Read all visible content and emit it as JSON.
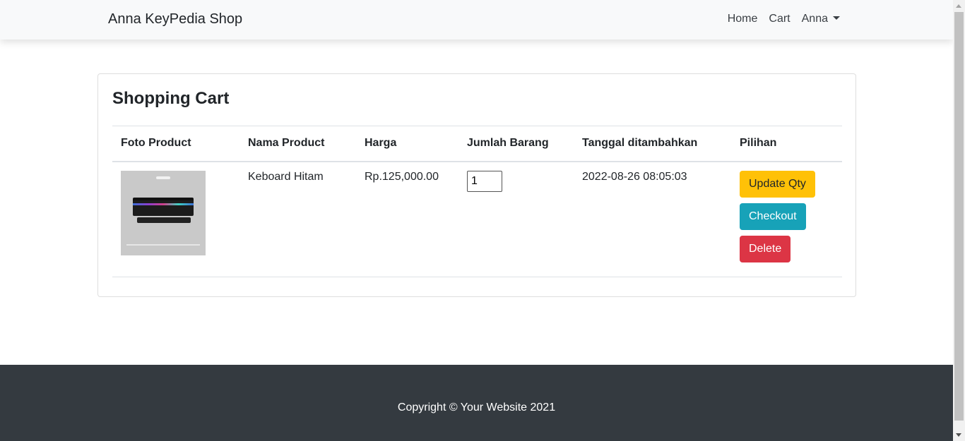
{
  "navbar": {
    "brand": "Anna KeyPedia Shop",
    "links": {
      "home": "Home",
      "cart": "Cart"
    },
    "user": "Anna"
  },
  "cart": {
    "title": "Shopping Cart",
    "headers": {
      "foto": "Foto Product",
      "nama": "Nama Product",
      "harga": "Harga",
      "jumlah": "Jumlah Barang",
      "tanggal": "Tanggal ditambahkan",
      "pilihan": "Pilihan"
    },
    "items": [
      {
        "image": "keyboard-product-photo",
        "nama": "Keboard Hitam",
        "harga": "Rp.125,000.00",
        "qty": "1",
        "tanggal": "2022-08-26 08:05:03",
        "actions": {
          "update": "Update Qty",
          "checkout": "Checkout",
          "delete": "Delete"
        }
      }
    ]
  },
  "colors": {
    "navbar_bg": "#f8f9fa",
    "warning": "#ffc107",
    "info": "#17a2b8",
    "danger": "#dc3545",
    "footer_bg": "#343a40"
  },
  "footer": {
    "text": "Copyright © Your Website 2021"
  }
}
